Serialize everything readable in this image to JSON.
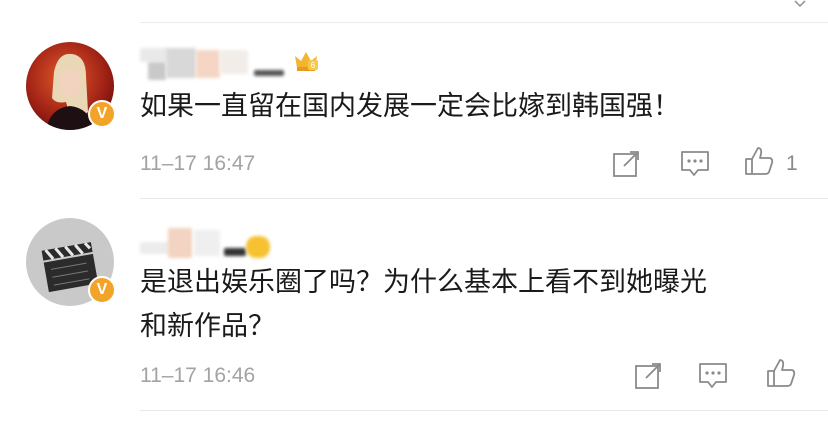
{
  "comments": [
    {
      "text": "如果一直留在国内发展一定会比嫁到韩国强！",
      "time": "11–17 16:47",
      "like_count": "1",
      "badge": "V",
      "icons": [
        "share-icon",
        "comment-icon",
        "like-icon"
      ]
    },
    {
      "text_line1": "是退出娱乐圈了吗？为什么基本上看不到她曝光",
      "text_line2": "和新作品？",
      "time": "11–17 16:46",
      "badge": "V",
      "icons": [
        "share-icon",
        "comment-icon",
        "like-icon"
      ]
    }
  ],
  "colors": {
    "badge": "#f1a32a",
    "meta": "#a3a3a3",
    "text": "#1a1a1a",
    "icon": "#8a8a8a"
  }
}
